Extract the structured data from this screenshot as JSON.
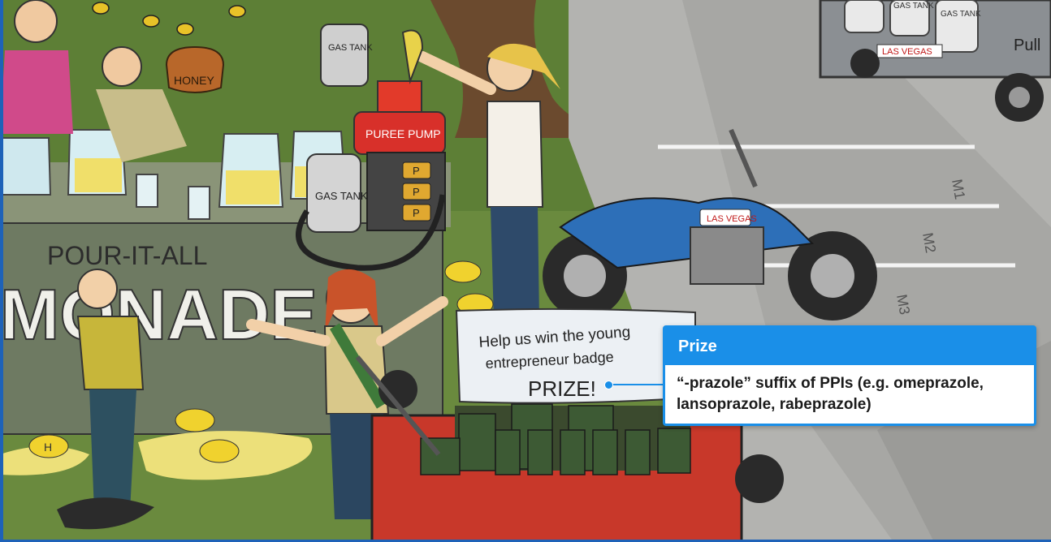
{
  "scene": {
    "sign": {
      "top_text": "POUR-IT-ALL",
      "big_text": "MONADE"
    },
    "pitcher_label": "HONEY",
    "gas_tank_labels": [
      "GAS TANK",
      "GAS TANK",
      "GAS TANK",
      "GAS TANK"
    ],
    "puree_pump_label": "PUREE PUMP",
    "pump_buttons": [
      "P",
      "P",
      "P"
    ],
    "banner": {
      "line1": "Help us win the young",
      "line2": "entrepreneur badge",
      "line3": "PRIZE!"
    },
    "motorcycle_sticker": "LAS VEGAS",
    "truck": {
      "sticker": "LAS VEGAS",
      "tank_labels": [
        "GAS TANK",
        "GAS TANK"
      ],
      "side_text": "Pull"
    },
    "parking_labels": [
      "M1",
      "M2",
      "M3"
    ],
    "lemon_mark": "H"
  },
  "popup": {
    "title": "Prize",
    "body": "“-prazole” suffix of PPIs (e.g. omeprazole, lansoprazole, rabeprazole)"
  }
}
